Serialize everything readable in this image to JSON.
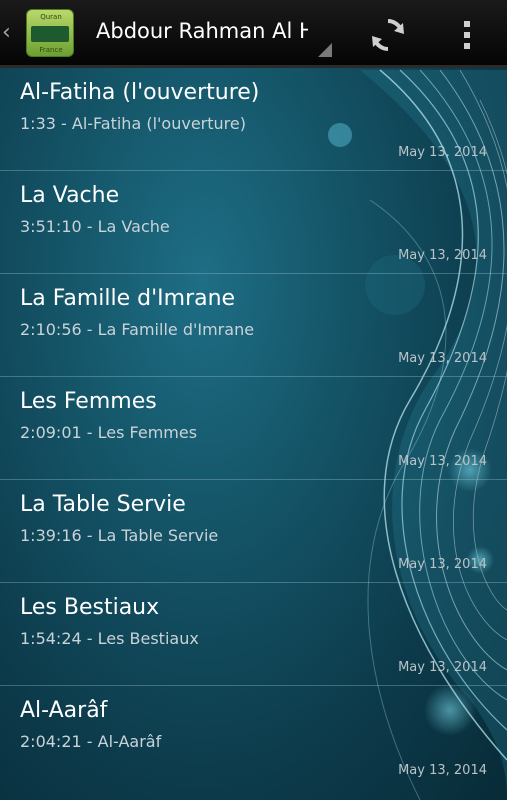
{
  "app": {
    "icon_text_top": "Quran",
    "icon_text_bottom": "France",
    "title": "Abdour Rahman Al H.."
  },
  "colors": {
    "action_bar": "#0d0d0d",
    "background": "#145366",
    "title_text": "#ffffff",
    "subtitle_text": "#c9d3d8"
  },
  "icons": {
    "up": "chevron-left-icon",
    "refresh": "refresh-icon",
    "overflow": "overflow-menu-icon"
  },
  "tracks": [
    {
      "title": "Al-Fatiha (l'ouverture)",
      "subtitle": "1:33 - Al-Fatiha (l'ouverture)",
      "date": "May 13, 2014"
    },
    {
      "title": "La Vache",
      "subtitle": "3:51:10 - La Vache",
      "date": "May 13, 2014"
    },
    {
      "title": "La Famille d'Imrane",
      "subtitle": "2:10:56 - La Famille d'Imrane",
      "date": "May 13, 2014"
    },
    {
      "title": "Les Femmes",
      "subtitle": "2:09:01 - Les Femmes",
      "date": "May 13, 2014"
    },
    {
      "title": "La Table Servie",
      "subtitle": "1:39:16 - La Table Servie",
      "date": "May 13, 2014"
    },
    {
      "title": "Les Bestiaux",
      "subtitle": "1:54:24 - Les Bestiaux",
      "date": "May 13, 2014"
    },
    {
      "title": "Al-Aarâf",
      "subtitle": "2:04:21 - Al-Aarâf",
      "date": "May 13, 2014"
    }
  ]
}
